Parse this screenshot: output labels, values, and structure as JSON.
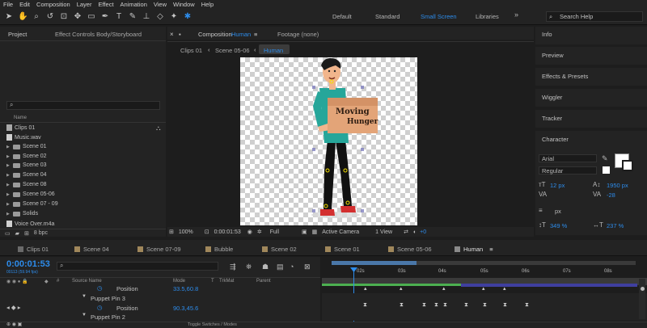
{
  "menu": [
    "File",
    "Edit",
    "Composition",
    "Layer",
    "Effect",
    "Animation",
    "View",
    "Window",
    "Help"
  ],
  "workspaces": {
    "default": "Default",
    "standard": "Standard",
    "small_screen": "Small Screen",
    "libraries": "Libraries"
  },
  "search_help": "Search Help",
  "project": {
    "tab": "Project",
    "effect_controls": "Effect Controls Body/Storyboard",
    "column_name": "Name",
    "items": [
      {
        "label": "Clips 01",
        "type": "comp"
      },
      {
        "label": "Music.wav",
        "type": "file"
      },
      {
        "label": "Scene 01",
        "type": "folder"
      },
      {
        "label": "Scene 02",
        "type": "folder"
      },
      {
        "label": "Scene 03",
        "type": "folder"
      },
      {
        "label": "Scene 04",
        "type": "folder"
      },
      {
        "label": "Scene 08",
        "type": "folder"
      },
      {
        "label": "Scene 05-06",
        "type": "folder"
      },
      {
        "label": "Scene 07 - 09",
        "type": "folder"
      },
      {
        "label": "Solids",
        "type": "folder"
      },
      {
        "label": "Voice Over.m4a",
        "type": "file"
      }
    ],
    "bpc": "8 bpc"
  },
  "viewer": {
    "comp_label": "Composition",
    "comp_name": "Human",
    "footage": "Footage (none)",
    "breadcrumbs": [
      "Clips 01",
      "Scene 05-06",
      "Human"
    ],
    "zoom": "100%",
    "timecode": "0:00:01:53",
    "resolution": "Full",
    "camera": "Active Camera",
    "views": "1 View",
    "offset": "+0",
    "box_text_1": "Moving",
    "box_text_2": "Hunger"
  },
  "right_panels": [
    "Info",
    "Preview",
    "Effects & Presets",
    "Wiggler",
    "Tracker",
    "Character"
  ],
  "character": {
    "font": "Arial",
    "style": "Regular",
    "size": "12 px",
    "leading": "1950 px",
    "tracking": "-28",
    "unit": "px",
    "scale_v": "349 %",
    "scale_h": "237 %"
  },
  "timeline": {
    "tabs": [
      "Clips 01",
      "Scene 04",
      "Scene 07-09",
      "Bubble",
      "Scene 02",
      "Scene 01",
      "Scene 05-06",
      "Human"
    ],
    "active_tab": "Human",
    "timecode": "0:00:01:53",
    "frame_info": "00113 (59.94 fps)",
    "col_source": "Source Name",
    "col_mode": "Mode",
    "col_t": "T",
    "col_trkmat": "TrkMat",
    "col_parent": "Parent",
    "ruler": [
      "02s",
      "03s",
      "04s",
      "05s",
      "06s",
      "07s",
      "08s"
    ],
    "rows": [
      {
        "label": "Position",
        "value": "33.5,60.8"
      },
      {
        "label": "Puppet Pin 3",
        "value": ""
      },
      {
        "label": "Position",
        "value": "90.3,45.6"
      },
      {
        "label": "Puppet Pin 2",
        "value": ""
      }
    ],
    "footer": "Toggle Switches / Modes"
  }
}
